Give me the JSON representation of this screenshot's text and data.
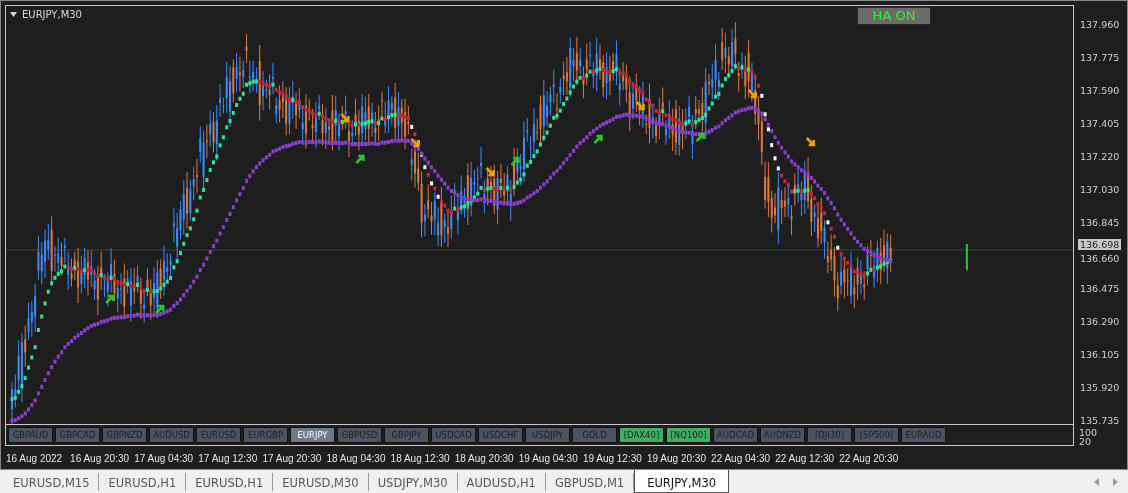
{
  "chart": {
    "title": "EURJPY,M30",
    "ha_button": "HA ON",
    "current_price": "136.698",
    "price_axis": [
      "137.960",
      "137.775",
      "137.590",
      "137.405",
      "137.220",
      "137.030",
      "136.845",
      "136.660",
      "136.475",
      "136.290",
      "136.105",
      "135.920",
      "135.735"
    ],
    "indicator_scale": [
      "100",
      "20"
    ],
    "time_axis": [
      "16 Aug 2022",
      "16 Aug 20:30",
      "17 Aug 04:30",
      "17 Aug 12:30",
      "17 Aug 20:30",
      "18 Aug 04:30",
      "18 Aug 12:30",
      "18 Aug 20:30",
      "19 Aug 04:30",
      "19 Aug 12:30",
      "19 Aug 20:30",
      "22 Aug 04:30",
      "22 Aug 12:30",
      "22 Aug 20:30"
    ]
  },
  "symbol_buttons": [
    {
      "label": "GBPAUD",
      "selected": false,
      "highlighted": false
    },
    {
      "label": "GBPCAD",
      "selected": false,
      "highlighted": false
    },
    {
      "label": "GBPNZD",
      "selected": false,
      "highlighted": false
    },
    {
      "label": "AUDUSD",
      "selected": false,
      "highlighted": false
    },
    {
      "label": "EURUSD",
      "selected": false,
      "highlighted": false
    },
    {
      "label": "EURGBP",
      "selected": false,
      "highlighted": false
    },
    {
      "label": "EURJPY",
      "selected": true,
      "highlighted": false
    },
    {
      "label": "GBPUSD",
      "selected": false,
      "highlighted": false
    },
    {
      "label": "GBPJPY",
      "selected": false,
      "highlighted": false
    },
    {
      "label": "USDCAD",
      "selected": false,
      "highlighted": false
    },
    {
      "label": "USDCHF",
      "selected": false,
      "highlighted": false
    },
    {
      "label": "USDJPY",
      "selected": false,
      "highlighted": false
    },
    {
      "label": "GOLD",
      "selected": false,
      "highlighted": false
    },
    {
      "label": "[DAX40]",
      "selected": false,
      "highlighted": true
    },
    {
      "label": "[NQ100]",
      "selected": false,
      "highlighted": true
    },
    {
      "label": "AUDCAD",
      "selected": false,
      "highlighted": false
    },
    {
      "label": "AUDNZD",
      "selected": false,
      "highlighted": false
    },
    {
      "label": "[DJI30]",
      "selected": false,
      "highlighted": false
    },
    {
      "label": "[SP500]",
      "selected": false,
      "highlighted": false
    },
    {
      "label": "EURAUD",
      "selected": false,
      "highlighted": false
    }
  ],
  "tabs": [
    {
      "label": "EURUSD,M15",
      "selected": false
    },
    {
      "label": "EURUSD,H1",
      "selected": false
    },
    {
      "label": "EURUSD,H1",
      "selected": false
    },
    {
      "label": "EURUSD,M30",
      "selected": false
    },
    {
      "label": "USDJPY,M30",
      "selected": false
    },
    {
      "label": "AUDUSD,H1",
      "selected": false
    },
    {
      "label": "GBPUSD,M1",
      "selected": false
    },
    {
      "label": "EURJPY,M30",
      "selected": true
    }
  ]
}
